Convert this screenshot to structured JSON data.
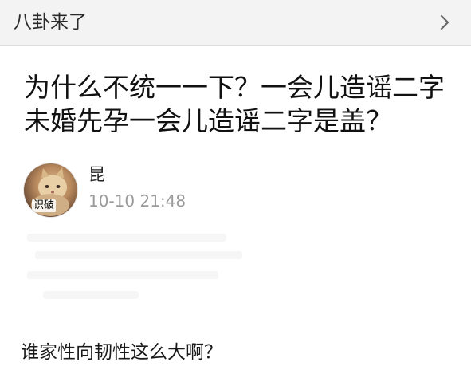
{
  "header": {
    "title": "八卦来了",
    "chevron_icon": "chevron-right-icon"
  },
  "post": {
    "title": "为什么不统一一下？一会儿造谣二字\n未婚先孕一会儿造谣二字是盖？"
  },
  "author": {
    "name": "昆",
    "avatar_caption": "识破",
    "timestamp": "10-10 21:48"
  },
  "comment": {
    "text": "谁家性向韧性这么大啊？"
  }
}
